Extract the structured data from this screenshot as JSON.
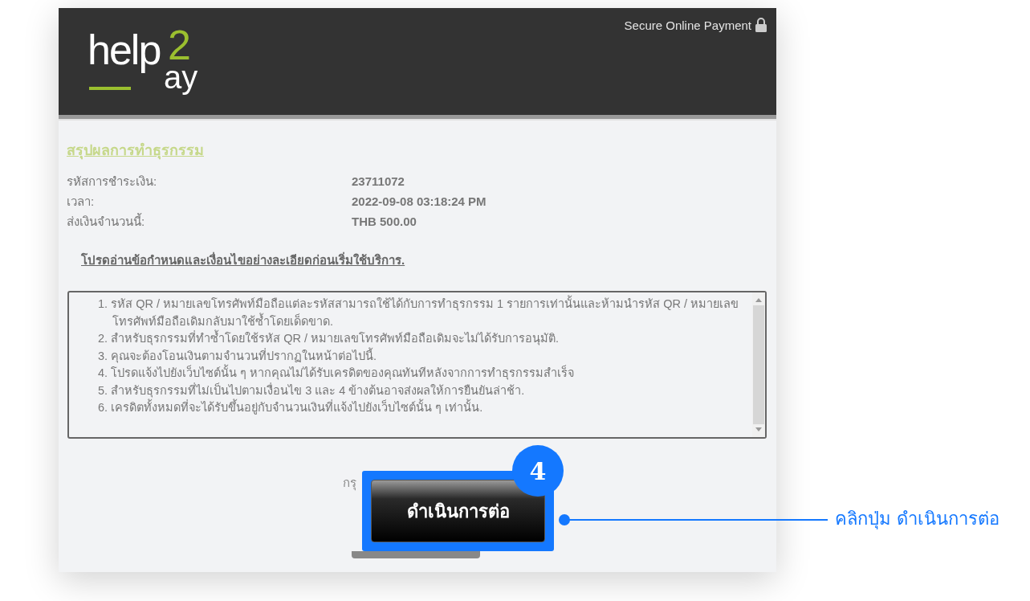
{
  "header": {
    "logo": {
      "word": "help",
      "digit": "2",
      "tail": "ay"
    },
    "secure_label": "Secure Online Payment"
  },
  "summary": {
    "title": "สรุปผลการทำธุรกรรม",
    "rows": [
      {
        "label": "รหัสการชำระเงิน:",
        "value": "23711072"
      },
      {
        "label": "เวลา:",
        "value": "2022-09-08 03:18:24 PM"
      },
      {
        "label": "ส่งเงินจำนวนนี้:",
        "value": "THB 500.00"
      }
    ]
  },
  "terms": {
    "heading": "โปรดอ่านข้อกำหนดและเงื่อนไขอย่างละเอียดก่อนเริ่มใช้บริการ.",
    "items": [
      "1. รหัส QR / หมายเลขโทรศัพท์มือถือแต่ละรหัสสามารถใช้ได้กับการทำธุรกรรม 1 รายการเท่านั้นและห้ามนำรหัส QR / หมายเลขโทรศัพท์มือถือเดิมกลับมาใช้ซ้ำโดยเด็ดขาด.",
      "2. สำหรับธุรกรรมที่ทำซ้ำโดยใช้รหัส QR / หมายเลขโทรศัพท์มือถือเดิมจะไม่ได้รับการอนุมัติ.",
      "3. คุณจะต้องโอนเงินตามจำนวนที่ปรากฏในหน้าต่อไปนี้.",
      "4. โปรดแจ้งไปยังเว็บไซต์นั้น ๆ หากคุณไม่ได้รับเครดิตของคุณทันทีหลังจากการทำธุรกรรมสำเร็จ",
      "5. สำหรับธุรกรรมที่ไม่เป็นไปตามเงื่อนไข 3 และ 4 ข้างต้นอาจส่งผลให้การยืนยันล่าช้า.",
      "6. เครดิตทั้งหมดที่จะได้รับขึ้นอยู่กับจำนวนเงินที่แจ้งไปยังเว็บไซต์นั้น ๆ เท่านั้น."
    ]
  },
  "hint_fragment": "กรุ",
  "callout": {
    "step": "4",
    "button_label": "ดำเนินการต่อ",
    "caption": "คลิกปุ่ม ดำเนินการต่อ"
  }
}
